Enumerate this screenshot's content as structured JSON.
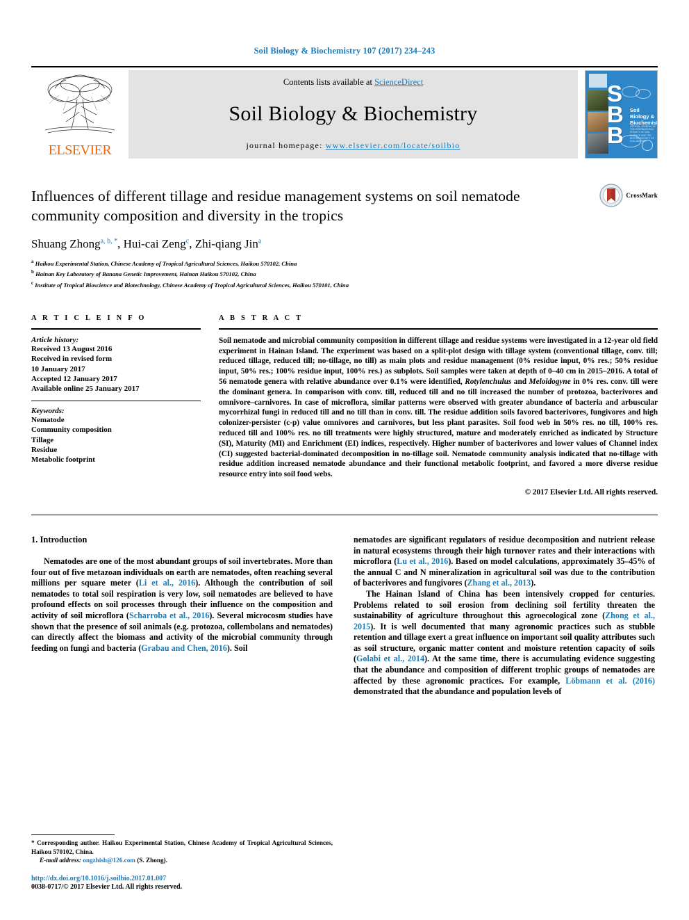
{
  "running_head": "Soil Biology & Biochemistry 107 (2017) 234–243",
  "masthead": {
    "publisher": "ELSEVIER",
    "contents_prefix": "Contents lists available at ",
    "contents_link": "ScienceDirect",
    "journal_title": "Soil Biology & Biochemistry",
    "homepage_prefix": "journal homepage: ",
    "homepage_url": "www.elsevier.com/locate/soilbio",
    "cover": {
      "letters": "S\nB\nB",
      "title": "Soil Biology & Biochemistry"
    }
  },
  "article": {
    "title": "Influences of different tillage and residue management systems on soil nematode community composition and diversity in the tropics",
    "crossmark_label": "CrossMark",
    "authors": [
      {
        "name": "Shuang Zhong",
        "marks": "a, b, *"
      },
      {
        "name": "Hui-cai Zeng",
        "marks": "c"
      },
      {
        "name": "Zhi-qiang Jin",
        "marks": "a"
      }
    ],
    "affiliations": [
      {
        "mark": "a",
        "text": "Haikou Experimental Station, Chinese Academy of Tropical Agricultural Sciences, Haikou 570102, China"
      },
      {
        "mark": "b",
        "text": "Hainan Key Laboratory of Banana Genetic Improvement, Hainan Haikou 570102, China"
      },
      {
        "mark": "c",
        "text": "Institute of Tropical Bioscience and Biotechnology, Chinese Academy of Tropical Agricultural Sciences, Haikou 570101, China"
      }
    ]
  },
  "article_info": {
    "heading": "A R T I C L E   I N F O",
    "history_label": "Article history:",
    "history": [
      "Received 13 August 2016",
      "Received in revised form",
      "10 January 2017",
      "Accepted 12 January 2017",
      "Available online 25 January 2017"
    ],
    "keywords_label": "Keywords:",
    "keywords": [
      "Nematode",
      "Community composition",
      "Tillage",
      "Residue",
      "Metabolic footprint"
    ]
  },
  "abstract": {
    "heading": "A B S T R A C T",
    "part1": "Soil nematode and microbial community composition in different tillage and residue systems were investigated in a 12-year old field experiment in Hainan Island. The experiment was based on a split-plot design with tillage system (conventional tillage, conv. till; reduced tillage, reduced till; no-tillage, no till) as main plots and residue management (0% residue input, 0% res.; 50% residue input, 50% res.; 100% residue input, 100% res.) as subplots. Soil samples were taken at depth of 0–40 cm in 2015–2016. A total of 56 nematode genera with relative abundance over 0.1% were identified, ",
    "italic1": "Rotylenchulus",
    "mid1": " and ",
    "italic2": "Meloidogyne",
    "part2": " in 0% res. conv. till were the dominant genera. In comparison with conv. till, reduced till and no till increased the number of protozoa, bacterivores and omnivore–carnivores. In case of microflora, similar patterns were observed with greater abundance of bacteria and arbuscular mycorrhizal fungi in reduced till and no till than in conv. till. The residue addition soils favored bacterivores, fungivores and high colonizer-persister (c-p) value omnivores and carnivores, but less plant parasites. Soil food web in 50% res. no till, 100% res. reduced till and 100% res. no till treatments were highly structured, mature and moderately enriched as indicated by Structure (SI), Maturity (MI) and Enrichment (EI) indices, respectively. Higher number of bacterivores and lower values of Channel index (CI) suggested bacterial-dominated decomposition in no-tillage soil. Nematode community analysis indicated that no-tillage with residue addition increased nematode abundance and their functional metabolic footprint, and favored a more diverse residue resource entry into soil food webs.",
    "copyright": "© 2017 Elsevier Ltd. All rights reserved."
  },
  "body": {
    "section_heading": "1. Introduction",
    "left_para1_a": "Nematodes are one of the most abundant groups of soil invertebrates. More than four out of five metazoan individuals on earth are nematodes, often reaching several millions per square meter (",
    "left_para1_ref1": "Li et al., 2016",
    "left_para1_b": "). Although the contribution of soil nematodes to total soil respiration is very low, soil nematodes are believed to have profound effects on soil processes through their influence on the composition and activity of soil microflora (",
    "left_para1_ref2": "Scharroba et al., 2016",
    "left_para1_c": "). Several microcosm studies have shown that the presence of soil animals (e.g. protozoa, collembolans and nematodes) can directly affect the biomass and activity of the microbial community through feeding on fungi and bacteria (",
    "left_para1_ref3": "Grabau and Chen, 2016",
    "left_para1_d": "). Soil",
    "right_para1_a": "nematodes are significant regulators of residue decomposition and nutrient release in natural ecosystems through their high turnover rates and their interactions with microflora (",
    "right_para1_ref1": "Lu et al., 2016",
    "right_para1_b": "). Based on model calculations, approximately 35–45% of the annual C and N mineralization in agricultural soil was due to the contribution of bacterivores and fungivores (",
    "right_para1_ref2": "Zhang et al., 2013",
    "right_para1_c": ").",
    "right_para2_a": "The Hainan Island of China has been intensively cropped for centuries. Problems related to soil erosion from declining soil fertility threaten the sustainability of agriculture throughout this agroecological zone (",
    "right_para2_ref1": "Zhong et al., 2015",
    "right_para2_b": "). It is well documented that many agronomic practices such as stubble retention and tillage exert a great influence on important soil quality attributes such as soil structure, organic matter content and moisture retention capacity of soils (",
    "right_para2_ref2": "Golabi et al., 2014",
    "right_para2_c": "). At the same time, there is accumulating evidence suggesting that the abundance and composition of different trophic groups of nematodes are affected by these agronomic practices. For example, ",
    "right_para2_ref3": "Löbmann et al. (2016)",
    "right_para2_d": " demonstrated that the abundance and population levels of"
  },
  "footnotes": {
    "corresponding": "* Corresponding author. Haikou Experimental Station, Chinese Academy of Tropical Agricultural Sciences, Haikou 570102, China.",
    "email_label": "E-mail address:",
    "email": "ongzhish@126.com",
    "email_suffix": " (S. Zhong).",
    "doi": "http://dx.doi.org/10.1016/j.soilbio.2017.01.007",
    "issn": "0038-0717/© 2017 Elsevier Ltd. All rights reserved."
  },
  "colors": {
    "link": "#1a7bb9",
    "elsevier_orange": "#ec6608",
    "cover_blue": "#2e86c8",
    "banner_gray": "#e3e3e3"
  }
}
